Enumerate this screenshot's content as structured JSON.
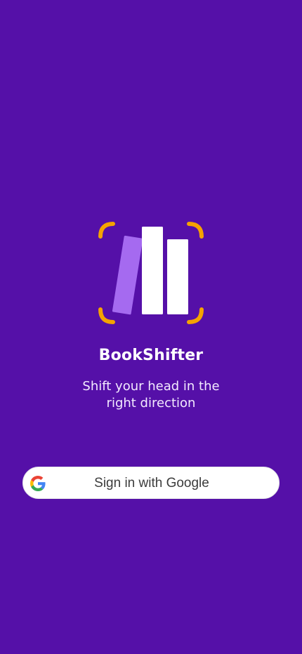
{
  "colors": {
    "background": "#5510A8",
    "accent_orange": "#F5A300",
    "book_light_purple": "#A56AF0",
    "book_white": "#FFFFFF"
  },
  "app": {
    "name": "BookShifter",
    "tagline": "Shift your head in the right direction"
  },
  "logo": {
    "icon": "bookshelf-logo-icon"
  },
  "auth": {
    "google_button_label": "Sign in with Google",
    "google_icon": "google-g-icon"
  }
}
